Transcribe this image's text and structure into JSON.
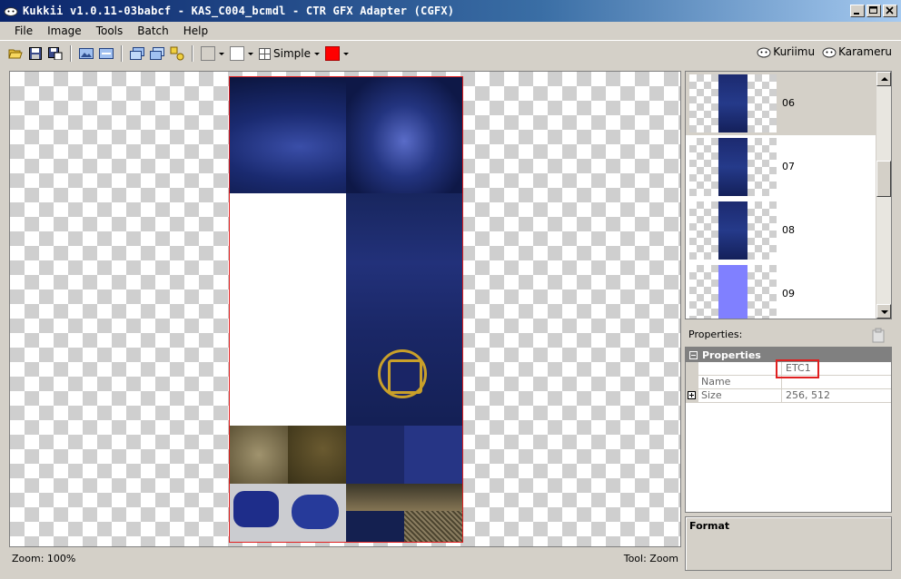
{
  "window": {
    "title": "Kukkii v1.0.11-03babcf - KAS_C004_bcmdl - CTR GFX Adapter (CGFX)"
  },
  "menu": {
    "items": [
      "File",
      "Image",
      "Tools",
      "Batch",
      "Help"
    ]
  },
  "toolbar": {
    "grid_label": "Simple",
    "swatch_colors": [
      "#d4d0c8",
      "#ffffff",
      "#ff0000"
    ],
    "links": [
      "Kuriimu",
      "Karameru"
    ]
  },
  "canvas": {
    "status_left": "Zoom: 100%",
    "status_right": "Tool: Zoom"
  },
  "thumbnails": [
    {
      "label": "06",
      "selected": true
    },
    {
      "label": "07",
      "selected": false
    },
    {
      "label": "08",
      "selected": false
    },
    {
      "label": "09",
      "selected": false
    }
  ],
  "properties": {
    "panel_label": "Properties:",
    "category": "Properties",
    "format_value": "ETC1",
    "rows": [
      {
        "name": "Name",
        "value": ""
      },
      {
        "name": "Size",
        "value": "256, 512"
      }
    ]
  },
  "format_box": {
    "title": "Format"
  }
}
